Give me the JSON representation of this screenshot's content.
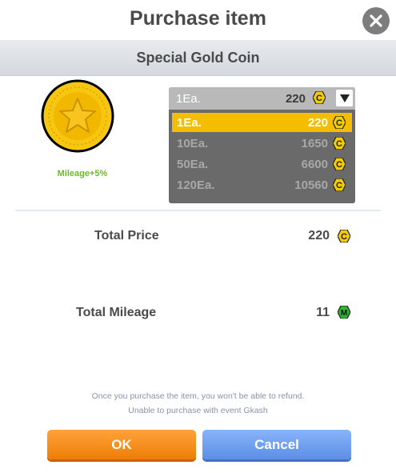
{
  "dialog": {
    "title": "Purchase item"
  },
  "item": {
    "name": "Special Gold Coin",
    "mileage_bonus": "Mileage+5%"
  },
  "dropdown": {
    "selected": {
      "qty": "1Ea.",
      "price": "220"
    },
    "options": [
      {
        "qty": "1Ea.",
        "price": "220",
        "selected": true
      },
      {
        "qty": "10Ea.",
        "price": "1650",
        "selected": false
      },
      {
        "qty": "50Ea.",
        "price": "6600",
        "selected": false
      },
      {
        "qty": "120Ea.",
        "price": "10560",
        "selected": false
      }
    ]
  },
  "totals": {
    "price_label": "Total Price",
    "price_value": "220",
    "mileage_label": "Total Mileage",
    "mileage_value": "11"
  },
  "icons": {
    "cash": "cash-coin-icon",
    "mileage": "mileage-icon",
    "currency_letter": "C",
    "mileage_letter": "M"
  },
  "notes": {
    "line1": "Once you purchase the item, you won't be able to refund.",
    "line2": "Unable to purchase with event Gkash"
  },
  "buttons": {
    "ok": "OK",
    "cancel": "Cancel"
  },
  "colors": {
    "accent_yellow": "#f4bd00",
    "ok_orange": "#f08a10",
    "cancel_blue": "#6e9ef0",
    "mileage_green": "#6dbb22"
  }
}
